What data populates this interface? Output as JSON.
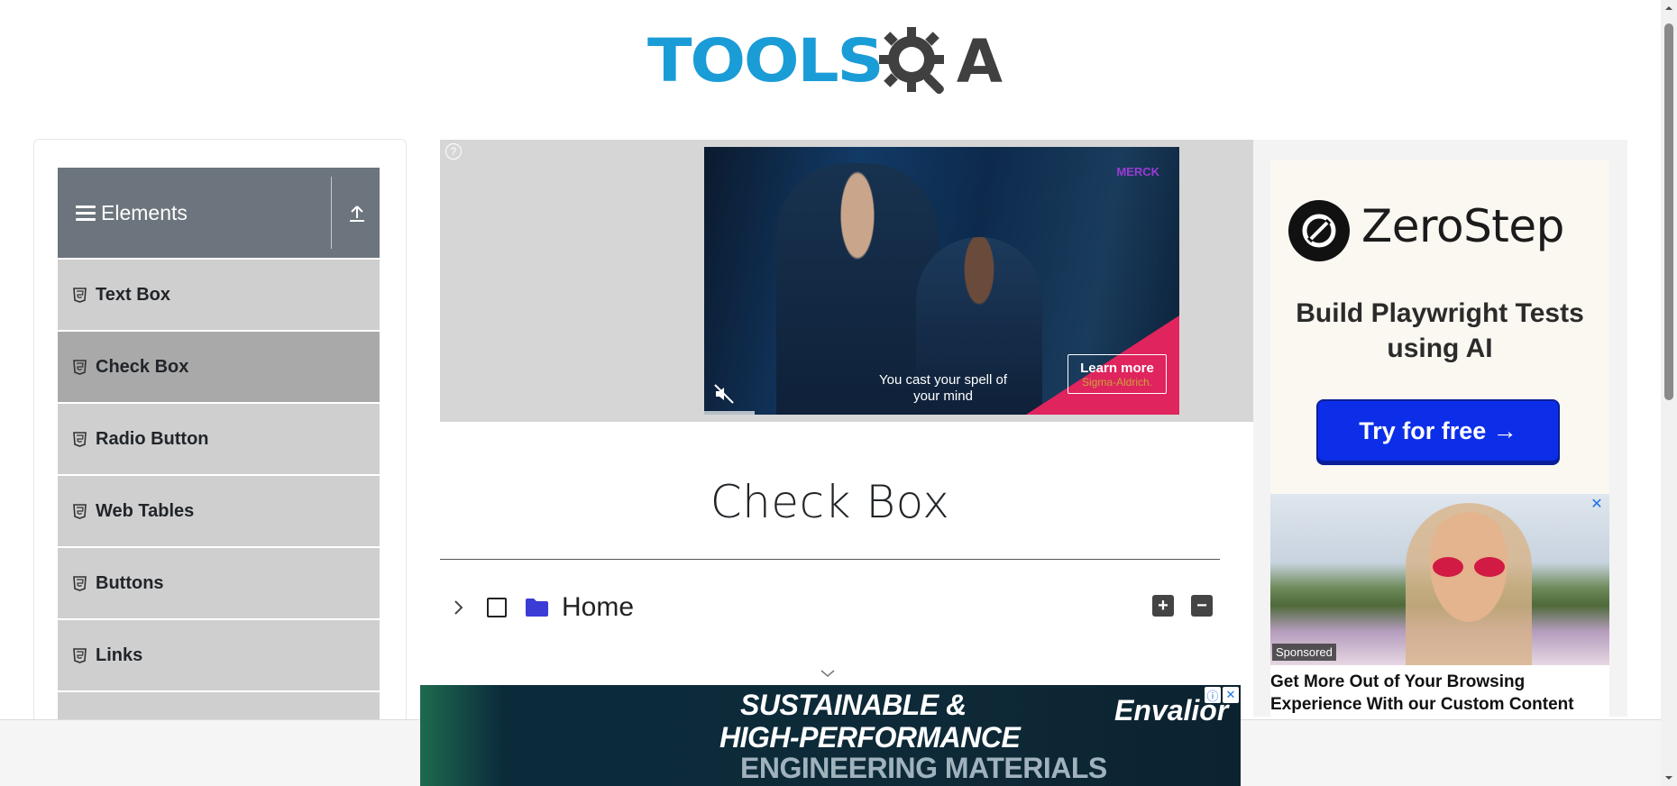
{
  "header": {
    "logo_text": "TOOLS",
    "logo_suffix": "A"
  },
  "sidebar": {
    "group_title": "Elements",
    "items": [
      {
        "label": "Text Box",
        "active": false
      },
      {
        "label": "Check Box",
        "active": true
      },
      {
        "label": "Radio Button",
        "active": false
      },
      {
        "label": "Web Tables",
        "active": false
      },
      {
        "label": "Buttons",
        "active": false
      },
      {
        "label": "Links",
        "active": false
      }
    ]
  },
  "video_ad": {
    "brand": "MERCK",
    "caption": "You cast your spell of your mind",
    "cta": "Learn more",
    "cta_sub": "Sigma-Aldrich."
  },
  "main": {
    "title": "Check Box",
    "tree": {
      "root_label": "Home",
      "checked": false,
      "expanded": false
    }
  },
  "right_ads": {
    "zerostep": {
      "name": "ZeroStep",
      "tagline": "Build Playwright Tests using AI",
      "cta": "Try for free →"
    },
    "sponsored": {
      "badge": "Sponsored",
      "headline": "Get More Out of Your Browsing Experience With our Custom Content"
    }
  },
  "bottom_ad": {
    "line1": "SUSTAINABLE &",
    "line2": "HIGH-PERFORMANCE",
    "line3": "ENGINEERING MATERIALS",
    "brand": "Envalior"
  },
  "colors": {
    "logo_blue": "#1a9cd7",
    "sidebar_header": "#6c757d",
    "menu_item": "#cfcfcf",
    "menu_item_active": "#a9a9a9",
    "zerostep_cta": "#0c2ee8",
    "folder": "#3b3bd6"
  }
}
